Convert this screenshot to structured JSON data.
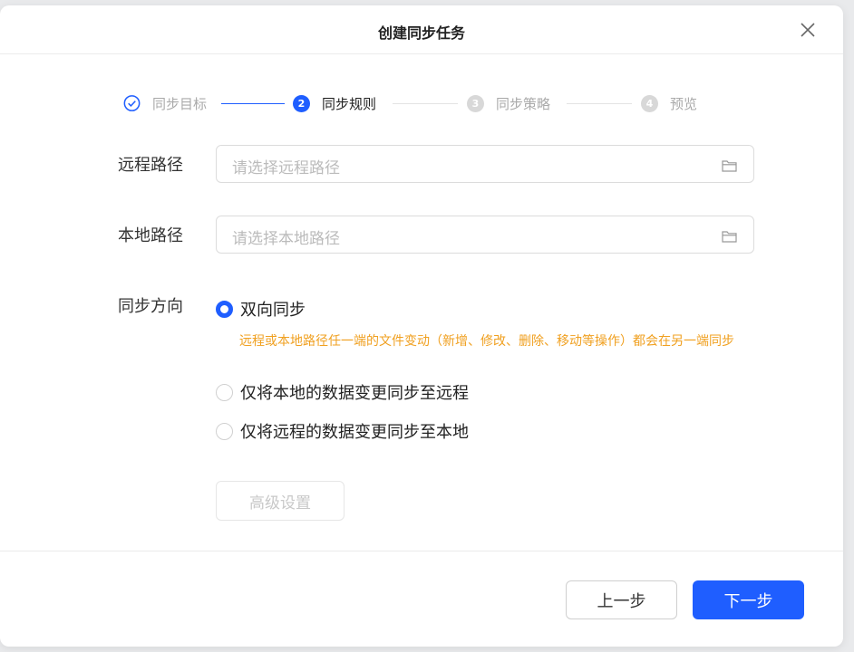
{
  "dialog": {
    "title": "创建同步任务"
  },
  "steps": [
    {
      "number": "1",
      "label": "同步目标",
      "state": "done"
    },
    {
      "number": "2",
      "label": "同步规则",
      "state": "active"
    },
    {
      "number": "3",
      "label": "同步策略",
      "state": "pending"
    },
    {
      "number": "4",
      "label": "预览",
      "state": "pending"
    }
  ],
  "form": {
    "remote_path": {
      "label": "远程路径",
      "placeholder": "请选择远程路径",
      "value": ""
    },
    "local_path": {
      "label": "本地路径",
      "placeholder": "请选择本地路径",
      "value": ""
    },
    "direction": {
      "label": "同步方向",
      "options": [
        {
          "label": "双向同步",
          "checked": true
        },
        {
          "label": "仅将本地的数据变更同步至远程",
          "checked": false
        },
        {
          "label": "仅将远程的数据变更同步至本地",
          "checked": false
        }
      ],
      "hint": "远程或本地路径任一端的文件变动（新增、修改、删除、移动等操作）都会在另一端同步"
    },
    "advanced_label": "高级设置"
  },
  "footer": {
    "prev_label": "上一步",
    "next_label": "下一步"
  },
  "colors": {
    "accent": "#1f5eff",
    "hint": "#f0a020",
    "inactive": "#bbbbbb"
  }
}
